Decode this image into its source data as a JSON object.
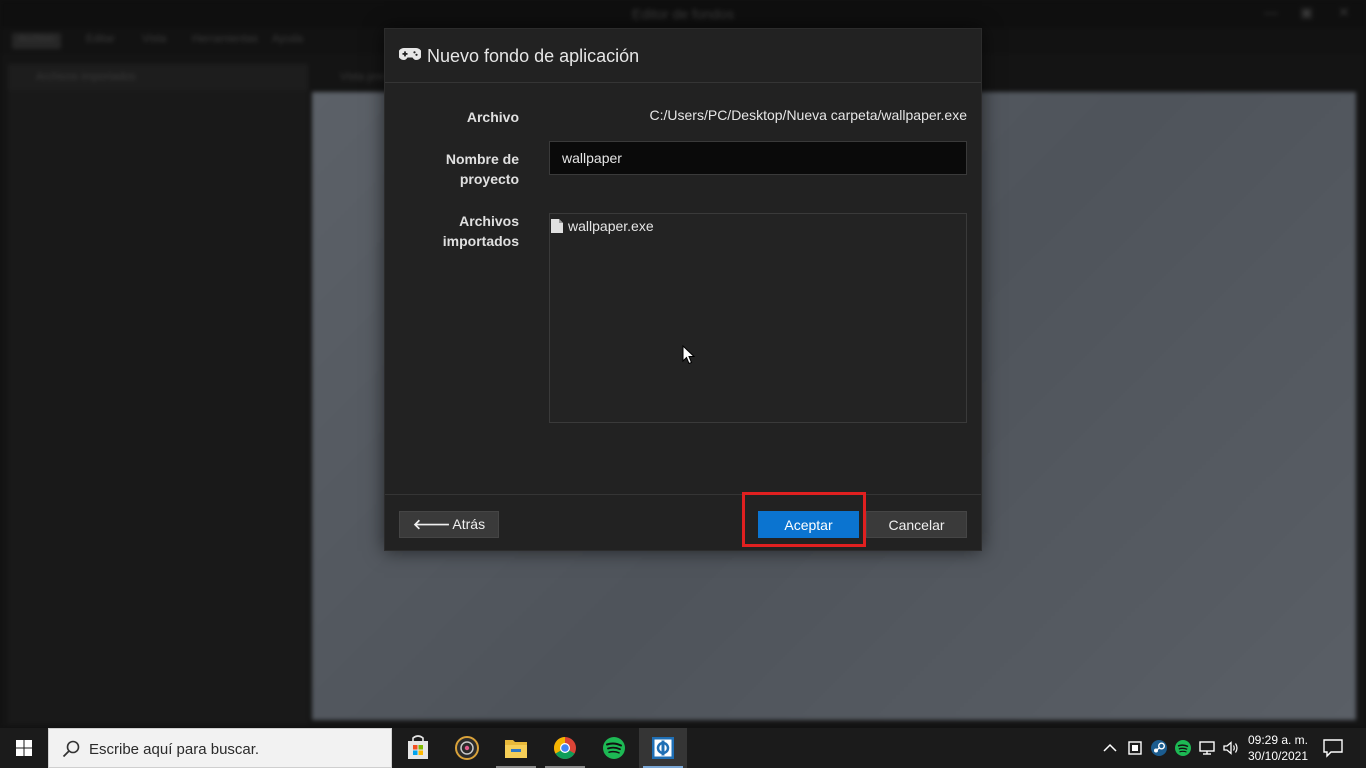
{
  "background_app": {
    "window_title": "Editor de fondos",
    "menu": [
      "Archivo",
      "Editar",
      "Vista",
      "Herramientas",
      "Ayuda"
    ],
    "sidebar_header": "Archivos importados",
    "preview_tab": "Vista previa"
  },
  "dialog": {
    "title": "Nuevo fondo de aplicación",
    "header_icon": "gamepad-icon",
    "file_label": "Archivo",
    "file_path": "C:/Users/PC/Desktop/Nueva carpeta/wallpaper.exe",
    "project_name_label": "Nombre de proyecto",
    "project_name_value": "wallpaper",
    "imported_files_label": "Archivos importados",
    "imported_files": [
      "wallpaper.exe"
    ],
    "back_label": "Atrás",
    "accept_label": "Aceptar",
    "cancel_label": "Cancelar",
    "accept_color": "#0b74d0",
    "highlight_color": "#e02020"
  },
  "taskbar": {
    "search_placeholder": "Escribe aquí para buscar.",
    "apps": [
      "microsoft-store-icon",
      "media-player-icon",
      "file-explorer-icon",
      "chrome-icon",
      "spotify-icon",
      "wallpaper-engine-icon"
    ],
    "tray_icons": [
      "show-hidden-icons-chevron",
      "tray-app-icon",
      "steam-icon",
      "spotify-tray-icon",
      "network-icon",
      "volume-icon"
    ],
    "time": "09:29 a. m.",
    "date": "30/10/2021"
  }
}
